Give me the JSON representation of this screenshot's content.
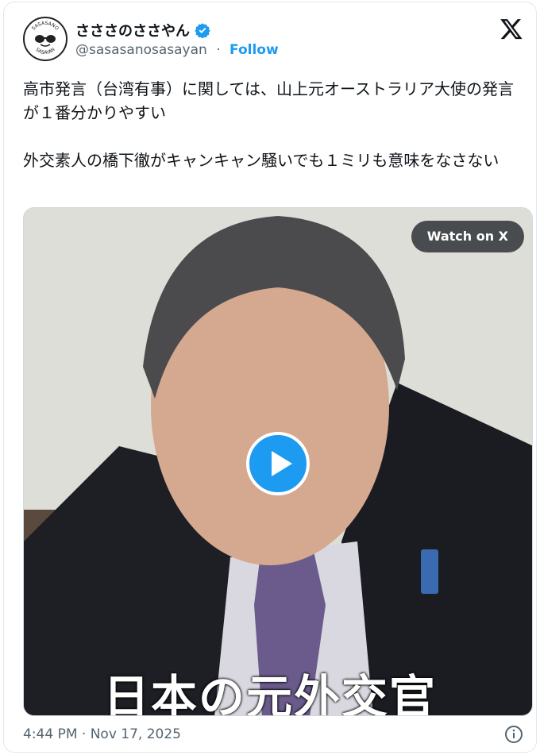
{
  "account": {
    "display_name": "さささのささやん",
    "handle": "@sasasanosasayan",
    "separator": "·",
    "follow_label": "Follow",
    "avatar_text_top": "SASASANO",
    "avatar_text_bottom": "SASAYAN"
  },
  "tweet": {
    "paragraph_1": "高市発言（台湾有事）に関しては、山上元オーストラリア大使の発言が１番分かりやすい",
    "paragraph_2": "外交素人の橋下徹がキャンキャン騒いでも１ミリも意味をなさない"
  },
  "media": {
    "watch_label": "Watch on X",
    "caption_text": "日本の元外交官"
  },
  "meta": {
    "timestamp": "4:44 PM · Nov 17, 2025"
  },
  "icons": {
    "verified": "verified-badge-icon",
    "x_logo": "x-logo-icon",
    "play": "play-icon",
    "info": "info-icon"
  },
  "colors": {
    "accent": "#1d9bf0",
    "text": "#0f1419",
    "secondary": "#536471"
  }
}
